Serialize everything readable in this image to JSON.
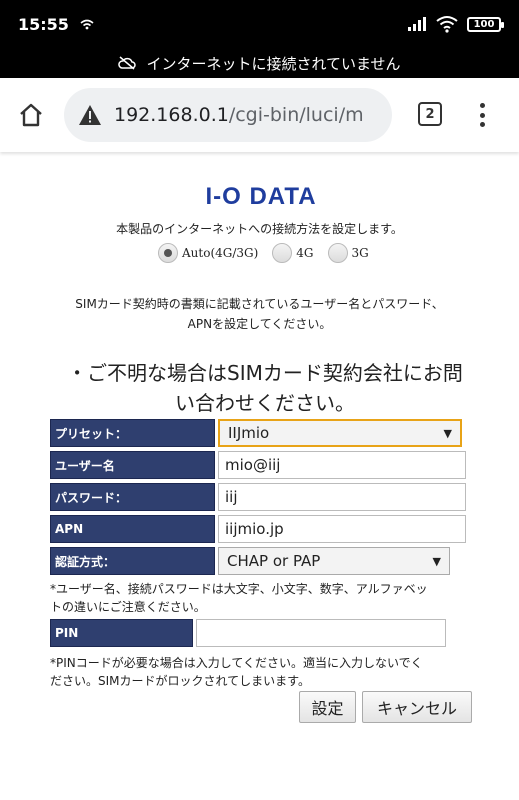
{
  "status_bar": {
    "time": "15:55",
    "battery": "100"
  },
  "offline_banner": {
    "text": "インターネットに接続されていません"
  },
  "browser": {
    "url_host": "192.168.0.1",
    "url_path": "/cgi-bin/luci/m",
    "tab_count": "2"
  },
  "page": {
    "logo_text": "I-O DATA",
    "intro": "本製品のインターネットへの接続方法を設定します。",
    "connection_options": [
      {
        "label": "Auto(4G/3G)",
        "checked": true
      },
      {
        "label": "4G",
        "checked": false
      },
      {
        "label": "3G",
        "checked": false
      }
    ],
    "note_line1": "SIMカード契約時の書類に記載されているユーザー名とパスワード、",
    "note_line2": "APNを設定してください。",
    "heading_line1": "・ご不明な場合はSIMカード契約会社にお問",
    "heading_line2": "い合わせください。",
    "form": {
      "preset_label": "プリセット：",
      "preset_value": "IIJmio",
      "username_label": "ユーザー名",
      "username_value": "mio@iij",
      "password_label": "パスワード：",
      "password_value": "iij",
      "apn_label": "APN",
      "apn_value": "iijmio.jp",
      "auth_label": "認証方式：",
      "auth_value": "CHAP or PAP",
      "case_note_line1": "*ユーザー名、接続パスワードは大文字、小文字、数字、アルファベッ",
      "case_note_line2": "トの違いにご注意ください。",
      "pin_label": "PIN",
      "pin_value": "",
      "pin_note_line1": "*PINコードが必要な場合は入力してください。適当に入力しないでく",
      "pin_note_line2": "ださい。SIMカードがロックされてしまいます。"
    },
    "buttons": {
      "apply": "設定",
      "cancel": "キャンセル"
    }
  },
  "colors": {
    "label_bg": "#2f3f6f",
    "logo_blue": "#1f3d9e",
    "focus_border": "#e8a317"
  }
}
